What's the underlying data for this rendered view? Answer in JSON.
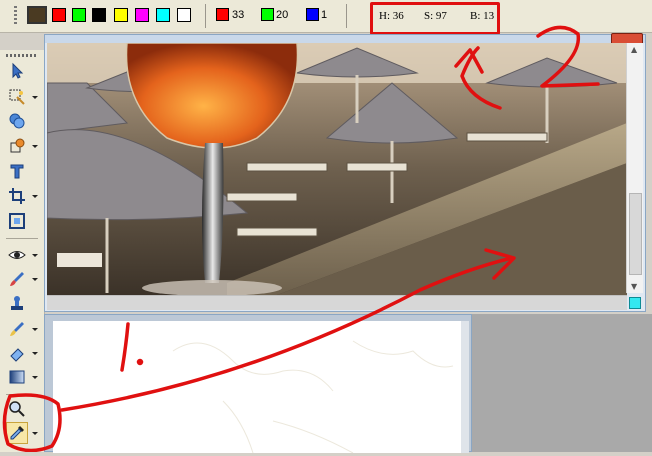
{
  "toolbar": {
    "swatches": [
      {
        "color": "#4a3a22",
        "selected": true
      },
      {
        "color": "#ff0000"
      },
      {
        "color": "#00ff00"
      },
      {
        "color": "#000000"
      },
      {
        "color": "#ffff00"
      },
      {
        "color": "#ff00ff"
      },
      {
        "color": "#00ffff"
      },
      {
        "color": "#ffffff"
      }
    ],
    "rgb": {
      "r_value": "33",
      "r_color": "#ff0000",
      "g_value": "20",
      "g_color": "#00ff00",
      "b_value": "1",
      "b_color": "#0000ff"
    },
    "hsb": {
      "h": "H: 36",
      "s": "S: 97",
      "b": "B: 13"
    }
  },
  "tools": [
    {
      "name": "pointer-icon"
    },
    {
      "name": "magic-select-icon"
    },
    {
      "name": "shapes-icon"
    },
    {
      "name": "freeform-shape-icon"
    },
    {
      "name": "text-icon"
    },
    {
      "name": "crop-icon"
    },
    {
      "name": "resize-icon"
    },
    {
      "name": "red-eye-icon"
    },
    {
      "name": "brush-icon"
    },
    {
      "name": "clone-stamp-icon"
    },
    {
      "name": "retouch-brush-icon"
    },
    {
      "name": "eraser-icon"
    },
    {
      "name": "gradient-icon"
    },
    {
      "name": "zoom-icon"
    },
    {
      "name": "eyedropper-icon",
      "active": true
    }
  ],
  "annotations": {
    "marker_1": "1.",
    "marker_2": "2",
    "color": "#e01010"
  },
  "photo": {
    "corner_color": "#33e8f0"
  }
}
